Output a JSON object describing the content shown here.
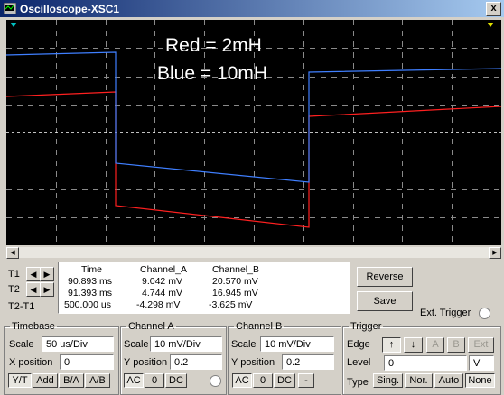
{
  "window": {
    "title": "Oscilloscope-XSC1",
    "close_label": "x"
  },
  "screen": {
    "caption_line1": "Red = 2mH",
    "caption_line2": "Blue = 10mH",
    "trace_colors": {
      "channel_a": "#ff2020",
      "channel_b": "#3f7fff",
      "ground": "#ffffff",
      "cursor_t1": "#00c0c0",
      "cursor_t2": "#e0e000"
    }
  },
  "cursors": {
    "t1_label": "T1",
    "t2_label": "T2",
    "diff_label": "T2-T1"
  },
  "readout": {
    "headers": [
      "Time",
      "Channel_A",
      "Channel_B"
    ],
    "rows": [
      [
        "90.893 ms",
        "9.042 mV",
        "20.570 mV"
      ],
      [
        "91.393 ms",
        "4.744 mV",
        "16.945 mV"
      ],
      [
        "500.000 us",
        "-4.298 mV",
        "-3.625 mV"
      ]
    ]
  },
  "buttons": {
    "reverse": "Reverse",
    "save": "Save"
  },
  "ext_trigger_label": "Ext. Trigger",
  "timebase": {
    "title": "Timebase",
    "scale_label": "Scale",
    "scale_value": "50 us/Div",
    "xpos_label": "X position",
    "xpos_value": "0",
    "modes": [
      "Y/T",
      "Add",
      "B/A",
      "A/B"
    ]
  },
  "channel_a": {
    "title": "Channel A",
    "scale_label": "Scale",
    "scale_value": "10 mV/Div",
    "ypos_label": "Y position",
    "ypos_value": "0.2",
    "coupling": [
      "AC",
      "0",
      "DC"
    ]
  },
  "channel_b": {
    "title": "Channel B",
    "scale_label": "Scale",
    "scale_value": "10 mV/Div",
    "ypos_label": "Y position",
    "ypos_value": "0.2",
    "coupling": [
      "AC",
      "0",
      "DC",
      "-"
    ]
  },
  "trigger": {
    "title": "Trigger",
    "edge_label": "Edge",
    "edge_buttons": [
      "↑",
      "↓",
      "A",
      "B",
      "Ext"
    ],
    "level_label": "Level",
    "level_value": "0",
    "level_unit": "V",
    "type_label": "Type",
    "type_buttons": [
      "Sing.",
      "Nor.",
      "Auto",
      "None"
    ]
  }
}
